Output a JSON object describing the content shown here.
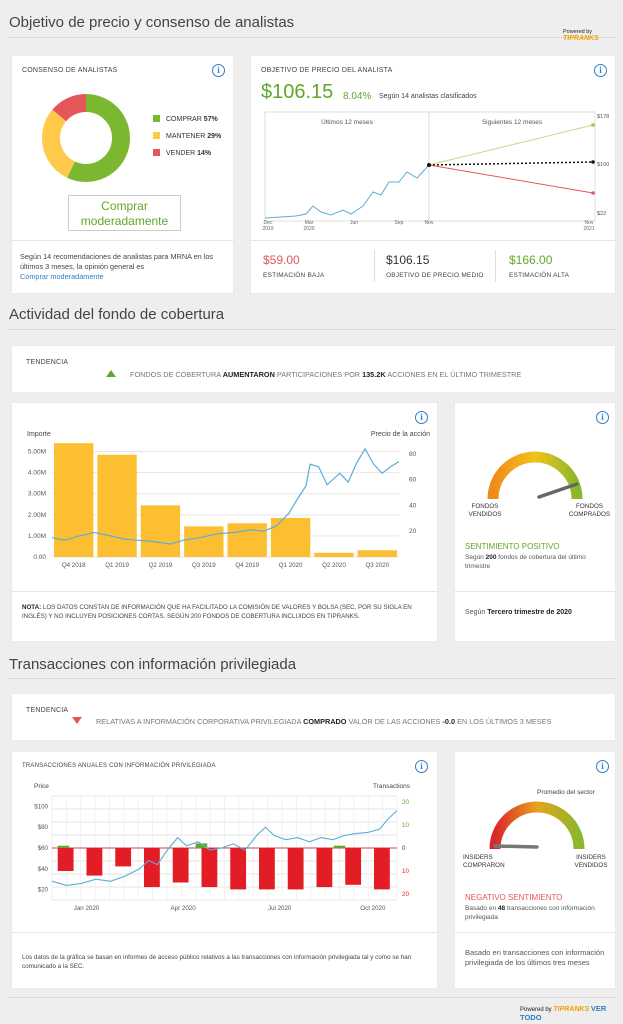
{
  "section1": {
    "title": "Objetivo de precio y consenso de analistas",
    "powered_by": "Powered by",
    "brand": "TIPRANKS"
  },
  "consensus": {
    "header": "CONSENSO DE ANALISTAS",
    "legend": [
      {
        "label": "COMPRAR",
        "pct": "57%",
        "color": "#7cb82f",
        "value": 57
      },
      {
        "label": "MANTENER",
        "pct": "29%",
        "color": "#ffc94a",
        "value": 29
      },
      {
        "label": "VENDER",
        "pct": "14%",
        "color": "#e5565b",
        "value": 14
      }
    ],
    "rating_button": "Comprar moderadamente",
    "summary": "Según 14 recomendaciones de analistas para MRNA en los últimos 3 meses, la opinión general es",
    "summary_link": "Comprar moderadamente"
  },
  "price_target": {
    "header": "OBJETIVO DE PRECIO DEL ANALISTA",
    "price": "$106.15",
    "change": "8.04%",
    "basis": "Según 14 analistas clasificados",
    "past_label": "Últimos 12 meses",
    "future_label": "Siguientes 12 meses",
    "x_ticks": [
      {
        "l1": "Dec",
        "l2": "2019"
      },
      {
        "l1": "Mar",
        "l2": "2020"
      },
      {
        "l1": "Jun",
        "l2": ""
      },
      {
        "l1": "Sep",
        "l2": ""
      },
      {
        "l1": "Nov",
        "l2": ""
      },
      {
        "l1": "Nov",
        "l2": "2021"
      }
    ],
    "targets": {
      "high": "$178",
      "mid": "$100",
      "low": "$22"
    },
    "stats": [
      {
        "value": "$59.00",
        "label": "ESTIMACIÓN BAJA",
        "color": "#e5565b"
      },
      {
        "value": "$106.15",
        "label": "OBJETIVO DE PRECIO MEDIO",
        "color": "#333333"
      },
      {
        "value": "$166.00",
        "label": "ESTIMACIÓN ALTA",
        "color": "#5fa82a"
      }
    ]
  },
  "hedge": {
    "title": "Actividad del fondo de cobertura",
    "trend_label": "TENDENCIA",
    "trend_pre": "FONDOS DE COBERTURA",
    "trend_bold": "AUMENTARON",
    "trend_mid": "PARTICIPACIONES POR",
    "trend_amount": "135.2K",
    "trend_post": "ACCIONES EN EL ÚLTIMO TRIMESTRE",
    "note_bold": "NOTA:",
    "note": "LOS DATOS CONSTAN DE INFORMACIÓN QUE HA FACILITADO LA COMISIÓN DE VALORES Y BOLSA (SEC, POR SU SIGLA EN INGLÉS) Y NO INCLUYEN POSICIONES CORTAS. SEGÚN 200 FONDOS DE COBERTURA INCLUIDOS EN TIPRANKS.",
    "gauge_left": "FONDOS VENDIDOS",
    "gauge_right": "FONDOS COMPRADOS",
    "sentiment": "SENTIMIENTO POSITIVO",
    "sentiment_pre": "Según",
    "sentiment_bold": "200",
    "sentiment_post": "fondos de cobertura del último trimestre",
    "quarter_pre": "Según",
    "quarter_bold": "Tercero trimestre de 2020"
  },
  "chart_data": [
    {
      "type": "bar",
      "title": "",
      "ylabel": "Importe",
      "y2label": "Precio de la acción",
      "categories": [
        "Q4 2018",
        "Q1 2019",
        "Q2 2019",
        "Q3 2019",
        "Q4 2019",
        "Q1 2020",
        "Q2 2020",
        "Q3 2020"
      ],
      "y_ticks": [
        "5.00M",
        "4.00M",
        "3.00M",
        "2.00M",
        "1.00M",
        "0.00"
      ],
      "y2_ticks": [
        "80",
        "60",
        "40",
        "20"
      ],
      "ylim": [
        0,
        5.5
      ],
      "y2lim": [
        0,
        90
      ],
      "values": [
        5.4,
        4.85,
        2.45,
        1.45,
        1.6,
        1.85,
        0.2,
        0.32
      ],
      "price_series": [
        [
          0,
          15
        ],
        [
          0.3,
          13
        ],
        [
          0.6,
          16
        ],
        [
          1.0,
          19
        ],
        [
          1.3,
          17
        ],
        [
          1.7,
          14
        ],
        [
          2.0,
          13
        ],
        [
          2.4,
          12
        ],
        [
          2.8,
          10
        ],
        [
          3.1,
          13
        ],
        [
          3.5,
          15
        ],
        [
          3.9,
          18
        ],
        [
          4.3,
          19
        ],
        [
          4.7,
          21
        ],
        [
          5.0,
          20
        ],
        [
          5.3,
          24
        ],
        [
          5.6,
          34
        ],
        [
          5.8,
          45
        ],
        [
          6.0,
          55
        ],
        [
          6.1,
          72
        ],
        [
          6.3,
          70
        ],
        [
          6.5,
          56
        ],
        [
          6.8,
          65
        ],
        [
          7.0,
          58
        ],
        [
          7.2,
          73
        ],
        [
          7.4,
          84
        ],
        [
          7.6,
          72
        ],
        [
          7.8,
          65
        ],
        [
          8.0,
          70
        ],
        [
          8.2,
          74
        ]
      ],
      "bar_color": "#fcbf32",
      "line_color": "#5aaed8"
    },
    {
      "type": "bar",
      "title": "TRANSACCIONES ANUALES CON INFORMACIÓN PRIVILEGIADA",
      "ylabel": "Price",
      "y2label": "Transactions",
      "x_ticks": [
        "Jan 2020",
        "Apr 2020",
        "Jul 2020",
        "Oct 2020"
      ],
      "y_ticks": [
        "$100",
        "$80",
        "$60",
        "$40",
        "$20"
      ],
      "y2_ticks": [
        "20",
        "10",
        "0",
        "10",
        "20"
      ],
      "sell_values": [
        -10,
        -12,
        -8,
        -17,
        -15,
        -17,
        -18,
        -18,
        -18,
        -17,
        -16,
        -18
      ],
      "buy_values": [
        1,
        0,
        0,
        0,
        0,
        0,
        2,
        0,
        0,
        0,
        0,
        0,
        1,
        0,
        0
      ],
      "price_series": [
        [
          0,
          28
        ],
        [
          0.5,
          24
        ],
        [
          1,
          26
        ],
        [
          1.5,
          30
        ],
        [
          2,
          28
        ],
        [
          2.5,
          33
        ],
        [
          3,
          40
        ],
        [
          3.3,
          48
        ],
        [
          3.6,
          44
        ],
        [
          4,
          60
        ],
        [
          4.3,
          70
        ],
        [
          4.6,
          62
        ],
        [
          5,
          66
        ],
        [
          5.4,
          58
        ],
        [
          5.8,
          60
        ],
        [
          6.2,
          64
        ],
        [
          6.6,
          58
        ],
        [
          7,
          72
        ],
        [
          7.3,
          80
        ],
        [
          7.6,
          72
        ],
        [
          8,
          68
        ],
        [
          8.4,
          70
        ],
        [
          8.8,
          66
        ],
        [
          9.2,
          70
        ],
        [
          9.6,
          68
        ],
        [
          10,
          72
        ],
        [
          10.4,
          74
        ],
        [
          10.8,
          75
        ],
        [
          11.2,
          78
        ],
        [
          11.5,
          88
        ],
        [
          11.8,
          96
        ]
      ],
      "sell_color": "#e31d25",
      "buy_color": "#5fa82a",
      "line_color": "#5aaed8"
    }
  ],
  "insider": {
    "title": "Transacciones con información privilegiada",
    "trend_label": "TENDENCIA",
    "trend_pre": "RELATIVAS A INFORMACIÓN CORPORATIVA PRIVILEGIADA",
    "trend_bold": "COMPRADO",
    "trend_mid": "VALOR DE LAS ACCIONES",
    "trend_amount": "-0.0",
    "trend_post": "EN LOS ÚLTIMOS 3 MESES",
    "note": "Los datos de la gráfica se basan en informes de acceso público relativos a las transacciones con información privilegiada tal y como se han comunicado a la SEC.",
    "gauge_top": "Promedio del sector",
    "gauge_left": "INSIDERS COMPRARON",
    "gauge_right": "INSIDERS VENDIDOS",
    "sentiment": "NEGATIVO SENTIMIENTO",
    "sentiment_pre": "Basado en",
    "sentiment_bold": "48",
    "sentiment_post": "transacciones con información privilegiada",
    "footer": "Basado en transacciones con información privilegiada de los últimos tres meses",
    "view_all": "VER TODO"
  }
}
